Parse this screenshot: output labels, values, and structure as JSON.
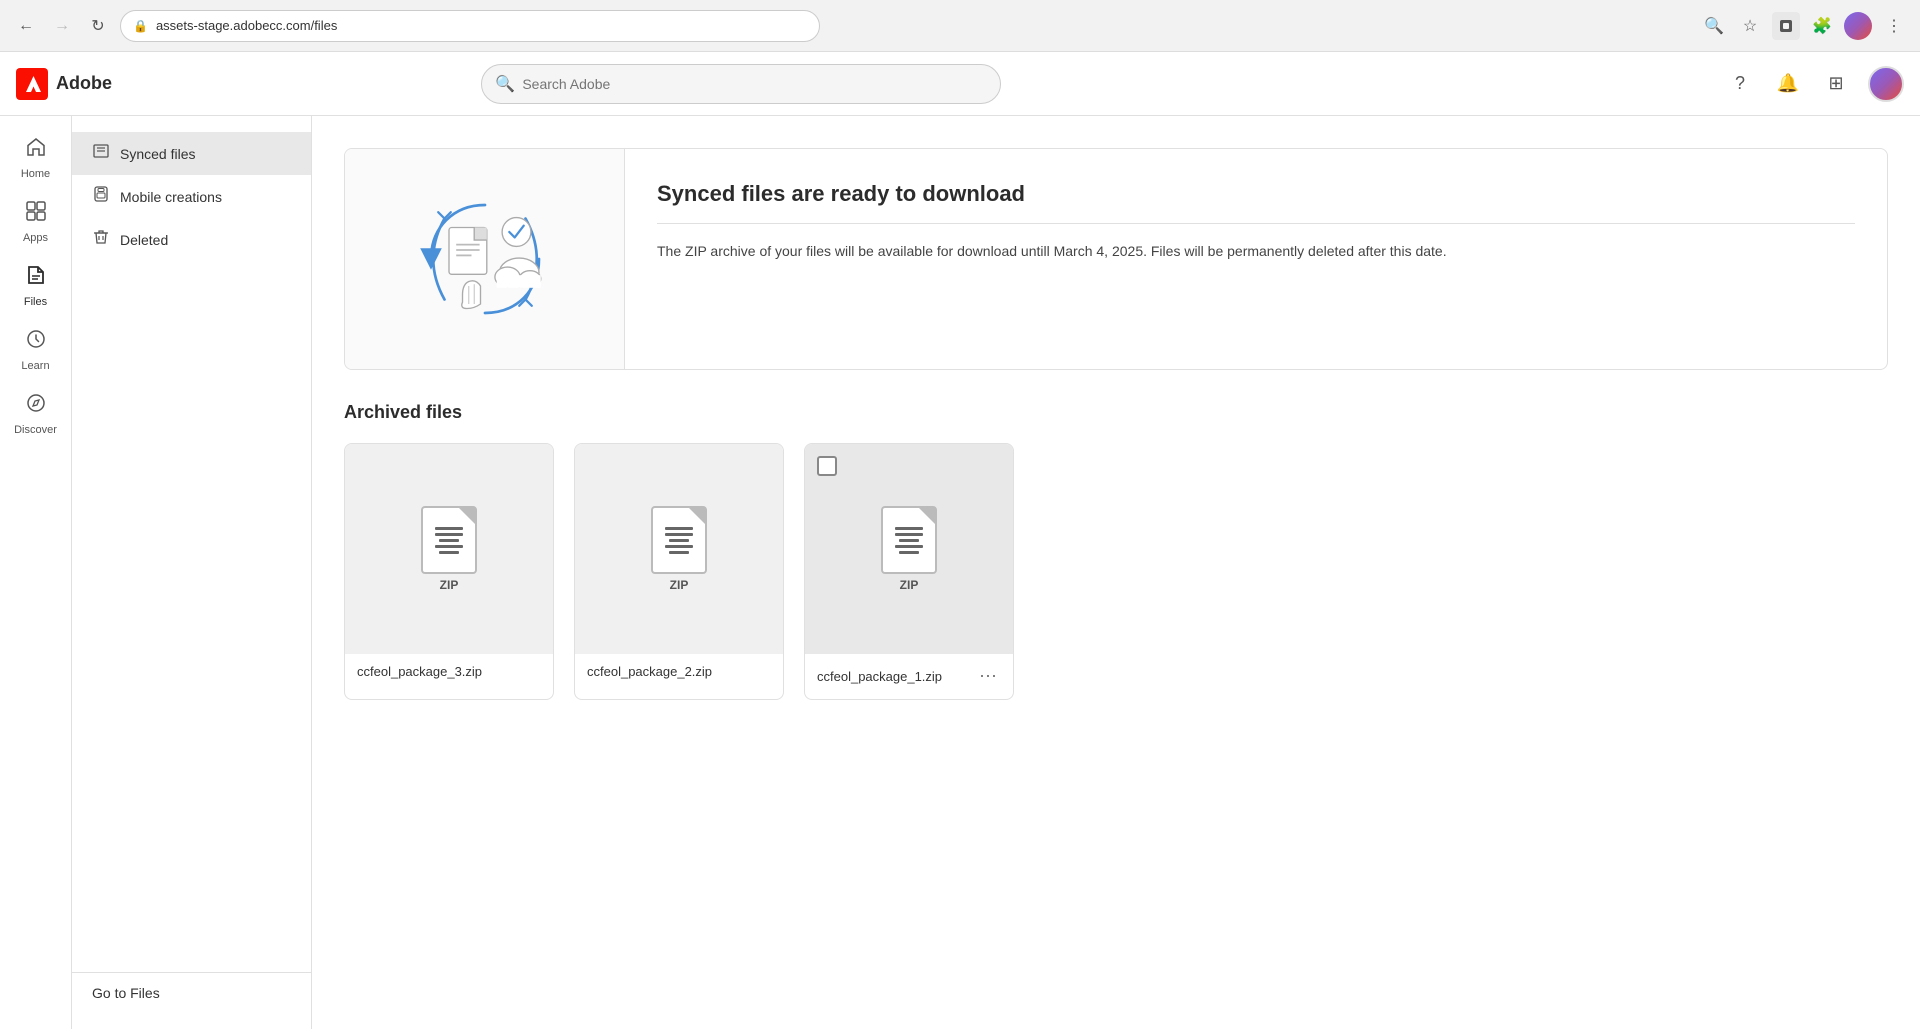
{
  "browser": {
    "url": "assets-stage.adobecc.com/files",
    "back_disabled": false,
    "forward_disabled": true
  },
  "header": {
    "logo_text": "Adobe",
    "search_placeholder": "Search Adobe",
    "help_label": "Help",
    "notifications_label": "Notifications",
    "apps_label": "Apps"
  },
  "sidebar_nav": {
    "items": [
      {
        "id": "home",
        "label": "Home",
        "icon": "⊞"
      },
      {
        "id": "apps",
        "label": "Apps",
        "icon": "⊡"
      },
      {
        "id": "files",
        "label": "Files",
        "icon": "📄"
      },
      {
        "id": "learn",
        "label": "Learn",
        "icon": "💡"
      },
      {
        "id": "discover",
        "label": "Discover",
        "icon": "🔍"
      }
    ],
    "active": "files"
  },
  "files_sidebar": {
    "items": [
      {
        "id": "synced",
        "label": "Synced files",
        "icon": "📄"
      },
      {
        "id": "mobile",
        "label": "Mobile creations",
        "icon": "⊞"
      },
      {
        "id": "deleted",
        "label": "Deleted",
        "icon": "🗑"
      }
    ],
    "active": "synced",
    "goto_files_label": "Go to Files"
  },
  "banner": {
    "title": "Synced files are ready to download",
    "description": "The ZIP archive of your files will be available for download untill March 4, 2025. Files will be permanently deleted after this date."
  },
  "archived_files": {
    "section_title": "Archived files",
    "files": [
      {
        "id": "file1",
        "name": "ccfeol_package_3.zip",
        "label": "ZIP",
        "highlighted": false,
        "show_checkbox": false,
        "show_more": false
      },
      {
        "id": "file2",
        "name": "ccfeol_package_2.zip",
        "label": "ZIP",
        "highlighted": false,
        "show_checkbox": false,
        "show_more": false
      },
      {
        "id": "file3",
        "name": "ccfeol_package_1.zip",
        "label": "ZIP",
        "highlighted": true,
        "show_checkbox": true,
        "show_more": true
      }
    ]
  }
}
